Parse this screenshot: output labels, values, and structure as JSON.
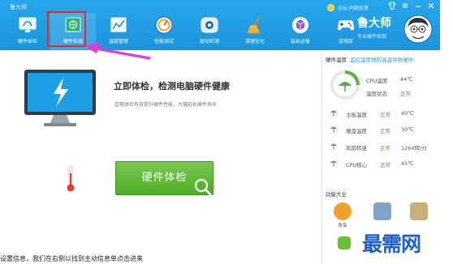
{
  "window": {
    "title": "鲁大师",
    "topbar_text": "论坛  问题反馈",
    "colors": {
      "header": "#1b94db",
      "accent_green": "#4eac2a",
      "highlight": "#e8272a",
      "arrow": "#e33bd4"
    }
  },
  "nav": {
    "items": [
      {
        "label": "硬件体检",
        "icon": "monitor-icon"
      },
      {
        "label": "硬件检测",
        "icon": "chip-icon"
      },
      {
        "label": "温度管理",
        "icon": "chart-icon"
      },
      {
        "label": "性能测试",
        "icon": "speedometer-icon"
      },
      {
        "label": "驱动检测",
        "icon": "driver-icon"
      },
      {
        "label": "清理优化",
        "icon": "broom-icon"
      },
      {
        "label": "装机必备",
        "icon": "package-icon"
      },
      {
        "label": "游戏库",
        "icon": "gamepad-icon"
      }
    ]
  },
  "brand": {
    "name": "鲁大师",
    "slogan": "专业硬件检测"
  },
  "main": {
    "headline": "立即体检，检测电脑硬件健康",
    "subline": "定期体检有效提升硬件性能，大幅延长硬件寿命",
    "check_button": "硬件体检"
  },
  "panel": {
    "title": "硬件温度",
    "subtitle": "监控温度预防高温导致硬件",
    "cpu_temp_label": "CPU温度",
    "cpu_temp_value": "44℃",
    "temp_state_label": "温度状态",
    "temp_state_value": "正常",
    "sensors": [
      {
        "name": "主板温度",
        "status": "正常",
        "value": "40℃"
      },
      {
        "name": "硬盘温度",
        "status": "正常",
        "value": "30℃"
      },
      {
        "name": "风扇转速",
        "status": "正常",
        "value": "1264转/分"
      },
      {
        "name": "CPU核心",
        "status": "正常",
        "value": "45℃"
      }
    ],
    "tools_title": "功能大全",
    "tools": [
      {
        "label": "鲁蛋",
        "color": "#f2a02b"
      },
      {
        "label": "",
        "color": "#7fa3c9"
      },
      {
        "label": "",
        "color": "#c9b07a"
      }
    ]
  },
  "watermark": "最需网",
  "caption": "设置信息，我们在右侧以找到主动信息单点击进来"
}
